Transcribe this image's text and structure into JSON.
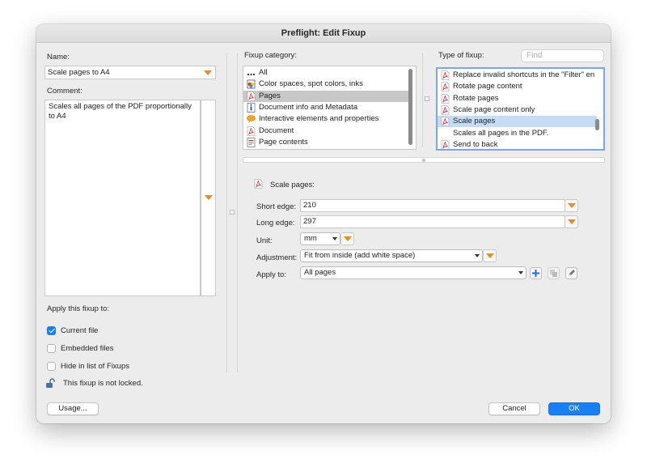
{
  "window": {
    "title": "Preflight: Edit Fixup"
  },
  "left": {
    "name_label": "Name:",
    "name_value": "Scale pages to A4",
    "comment_label": "Comment:",
    "comment_value": "Scales all pages of the PDF proportionally to A4",
    "apply_label": "Apply this fixup to:",
    "checkboxes": [
      {
        "label": "Current file",
        "checked": true
      },
      {
        "label": "Embedded files",
        "checked": false
      },
      {
        "label": "Hide in list of Fixups",
        "checked": false
      }
    ],
    "lock_text": "This fixup is not locked."
  },
  "category": {
    "label": "Fixup category:",
    "items": [
      {
        "label": "All",
        "icon": "ellipsis-icon"
      },
      {
        "label": "Color spaces, spot colors, inks",
        "icon": "color-icon"
      },
      {
        "label": "Pages",
        "icon": "pdf-icon",
        "selected": true
      },
      {
        "label": "Document info and Metadata",
        "icon": "info-icon"
      },
      {
        "label": "Interactive elements and properties",
        "icon": "comment-icon"
      },
      {
        "label": "Document",
        "icon": "pdf-icon"
      },
      {
        "label": "Page contents",
        "icon": "page-contents-icon"
      }
    ]
  },
  "type": {
    "label": "Type of fixup:",
    "find_placeholder": "Find",
    "items": [
      {
        "label": "Replace invalid shortcuts in the \"Filter\" en"
      },
      {
        "label": "Rotate page content"
      },
      {
        "label": "Rotate pages"
      },
      {
        "label": "Scale page content only"
      },
      {
        "label": "Scale pages",
        "selected": true
      },
      {
        "label": "Scales all pages in the PDF.",
        "description": true
      },
      {
        "label": "Send to back"
      }
    ]
  },
  "detail": {
    "title": "Scale pages:",
    "short_edge_label": "Short edge:",
    "short_edge_value": "210",
    "long_edge_label": "Long edge:",
    "long_edge_value": "297",
    "unit_label": "Unit:",
    "unit_value": "mm",
    "adjustment_label": "Adjustment:",
    "adjustment_value": "Fit from inside (add white space)",
    "apply_to_label": "Apply to:",
    "apply_to_value": "All pages"
  },
  "footer": {
    "usage_label": "Usage...",
    "cancel_label": "Cancel",
    "ok_label": "OK"
  },
  "colors": {
    "accent": "#1a7ff5",
    "orange": "#f08a1c",
    "pdf_red": "#d6262c"
  }
}
